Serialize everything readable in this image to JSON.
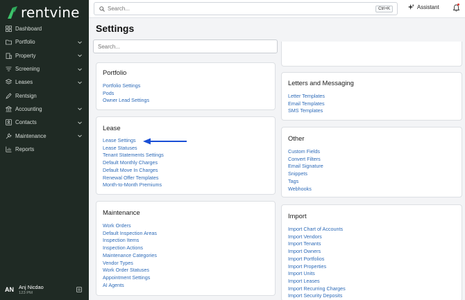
{
  "brand": {
    "name": "rentvine",
    "accent": "#3cc36a"
  },
  "sidebar": {
    "items": [
      {
        "label": "Dashboard",
        "icon": "grid-icon",
        "chevron": false
      },
      {
        "label": "Portfolio",
        "icon": "folder-icon",
        "chevron": true
      },
      {
        "label": "Property",
        "icon": "building-icon",
        "chevron": true
      },
      {
        "label": "Screening",
        "icon": "filter-icon",
        "chevron": true
      },
      {
        "label": "Leases",
        "icon": "layers-icon",
        "chevron": true
      },
      {
        "label": "Rentsign",
        "icon": "pen-icon",
        "chevron": false
      },
      {
        "label": "Accounting",
        "icon": "bank-icon",
        "chevron": true
      },
      {
        "label": "Contacts",
        "icon": "contacts-icon",
        "chevron": true
      },
      {
        "label": "Maintenance",
        "icon": "wrench-icon",
        "chevron": true
      },
      {
        "label": "Reports",
        "icon": "chart-icon",
        "chevron": false
      }
    ],
    "user": {
      "initials": "AN",
      "name": "Anj Nicdao",
      "time": "123 PM"
    }
  },
  "topbar": {
    "search_placeholder": "Search...",
    "shortcut": "Ctrl+K",
    "assistant_label": "Assistant"
  },
  "main": {
    "title": "Settings",
    "search_placeholder": "Search..."
  },
  "cards": {
    "portfolio": {
      "title": "Portfolio",
      "links": [
        "Portfolio Settings",
        "Pods",
        "Owner Lead Settings"
      ]
    },
    "lease": {
      "title": "Lease",
      "links": [
        "Lease Settings",
        "Lease Statuses",
        "Tenant Statements Settings",
        "Default Monthly Charges",
        "Default Move In Charges",
        "Renewal Offer Templates",
        "Month-to-Month Premiums"
      ]
    },
    "maintenance": {
      "title": "Maintenance",
      "links": [
        "Work Orders",
        "Default Inspection Areas",
        "Inspection Items",
        "Inspection Actions",
        "Maintenance Categories",
        "Vendor Types",
        "Work Order Statuses",
        "Appointment Settings",
        "AI Agents"
      ]
    },
    "letters": {
      "title": "Letters and Messaging",
      "links": [
        "Letter Templates",
        "Email Templates",
        "SMS Templates"
      ]
    },
    "other": {
      "title": "Other",
      "links": [
        "Custom Fields",
        "Convert Filters",
        "Email Signature",
        "Snippets",
        "Tags",
        "Webhooks"
      ]
    },
    "import": {
      "title": "Import",
      "links": [
        "Import Chart of Accounts",
        "Import Vendors",
        "Import Tenants",
        "Import Owners",
        "Import Portfolios",
        "Import Properties",
        "Import Units",
        "Import Leases",
        "Import Recurring Charges",
        "Import Security Deposits"
      ]
    }
  },
  "annotation": {
    "arrow_color": "#1a4fd6"
  }
}
